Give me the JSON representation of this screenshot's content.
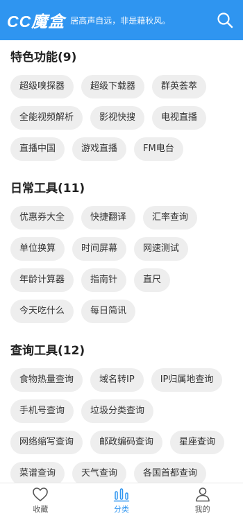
{
  "header": {
    "logo": "CC魔盒",
    "slogan": "居高声自远，非是藉秋风。",
    "icon": "search-icon",
    "color": "#2f95f0"
  },
  "sections": [
    {
      "title": "特色功能(9)",
      "items": [
        "超级嗅探器",
        "超级下载器",
        "群英荟萃",
        "全能视频解析",
        "影视快搜",
        "电视直播",
        "直播中国",
        "游戏直播",
        "FM电台"
      ]
    },
    {
      "title": "日常工具(11)",
      "items": [
        "优惠券大全",
        "快捷翻译",
        "汇率查询",
        "单位换算",
        "时间屏幕",
        "网速测试",
        "年龄计算器",
        "指南针",
        "直尺",
        "今天吃什么",
        "每日简讯"
      ]
    },
    {
      "title": "查询工具(12)",
      "items": [
        "食物热量查询",
        "域名转IP",
        "IP归属地查询",
        "手机号查询",
        "垃圾分类查询",
        "网络缩写查询",
        "邮政编码查询",
        "星座查询",
        "菜谱查询",
        "天气查询",
        "各国首都查询"
      ]
    }
  ],
  "tabbar": {
    "tabs": [
      {
        "label": "收藏",
        "icon": "heart-icon"
      },
      {
        "label": "分类",
        "icon": "bar-chart-icon"
      },
      {
        "label": "我的",
        "icon": "user-icon"
      }
    ],
    "active": "分类",
    "active_color": "#2f95f0"
  }
}
